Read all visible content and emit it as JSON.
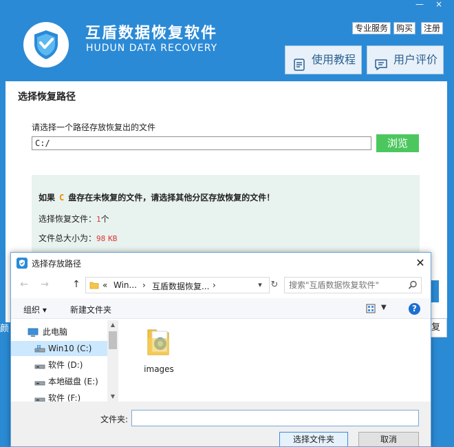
{
  "app": {
    "title": "互盾数据恢复软件",
    "subtitle": "HUDUN DATA RECOVERY",
    "window_controls": {
      "minimize": "—",
      "close": "×"
    },
    "top_links": [
      "专业服务",
      "购买",
      "注册"
    ],
    "tutorial_label": "使用教程",
    "review_label": "用户评价",
    "colors": {
      "header": "#2b8ad6",
      "browse": "#4cc75e",
      "warn_drive": "#f08a00",
      "stat_num": "#d33333"
    }
  },
  "panel": {
    "title": "选择恢复路径",
    "path_label": "请选择一个路径存放恢复出的文件",
    "path_value": "C:/",
    "browse_label": "浏览",
    "warning": {
      "prefix": "如果",
      "drive": "C",
      "suffix": "盘存在未恢复的文件，请选择其他分区存放恢复的文件！"
    },
    "selected_files": {
      "label": "选择恢复文件：",
      "value": "1",
      "unit": "个"
    },
    "total_size": {
      "label": "文件总大小为：",
      "value": "98",
      "unit": "KB"
    },
    "left_edge_text": "颜",
    "right_edge_text": "复"
  },
  "dialog": {
    "title": "选择存放路径",
    "close": "✕",
    "nav": {
      "back": "←",
      "forward": "→",
      "up": "↑"
    },
    "breadcrumb": [
      "«",
      "Win...",
      "›",
      "互盾数据恢复...",
      "›"
    ],
    "refresh": "↻",
    "search_placeholder": "搜索\"互盾数据恢复软件\"",
    "toolbar": {
      "organize": "组织 ▾",
      "new_folder": "新建文件夹",
      "help": "?"
    },
    "tree": [
      {
        "label": "此电脑",
        "icon": "computer-icon"
      },
      {
        "label": "Win10 (C:)",
        "icon": "drive-icon",
        "selected": true
      },
      {
        "label": "软件 (D:)",
        "icon": "drive-icon"
      },
      {
        "label": "本地磁盘 (E:)",
        "icon": "drive-icon"
      },
      {
        "label": "软件 (F:)",
        "icon": "drive-icon"
      }
    ],
    "files": [
      {
        "name": "images",
        "icon": "folder-icon"
      }
    ],
    "folder_label": "文件夹:",
    "folder_value": "",
    "select_button": "选择文件夹",
    "cancel_button": "取消"
  }
}
